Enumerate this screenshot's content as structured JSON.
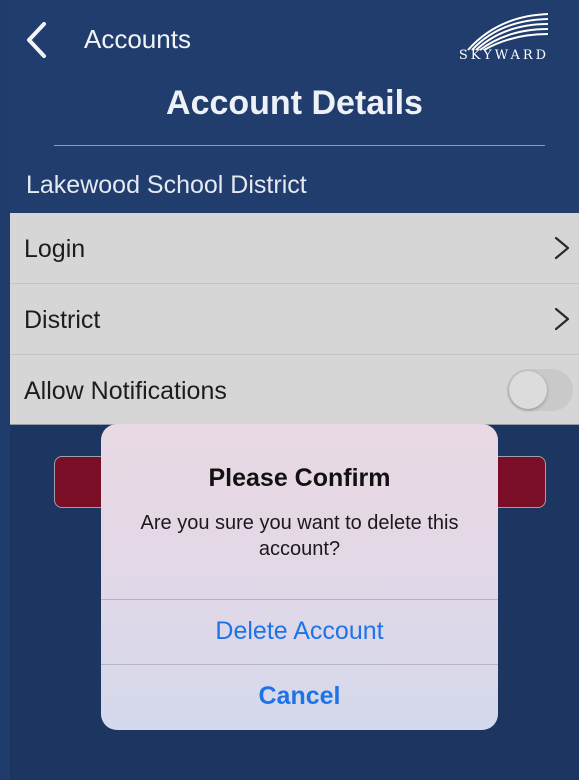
{
  "header": {
    "back_label": "Accounts",
    "page_title": "Account Details",
    "brand_text": "SKYWARD"
  },
  "section": {
    "title": "Lakewood School District"
  },
  "rows": [
    {
      "label": "Login",
      "control": "chevron"
    },
    {
      "label": "District",
      "control": "chevron"
    },
    {
      "label": "Allow Notifications",
      "control": "toggle",
      "enabled": false
    }
  ],
  "dialog": {
    "title": "Please Confirm",
    "message": "Are you sure you want to delete this account?",
    "primary_action": "Delete Account",
    "cancel_action": "Cancel"
  },
  "colors": {
    "background": "#213d6d",
    "list_background": "#d6d6d6",
    "delete_button": "#b10014",
    "action_blue": "#1f73e8"
  }
}
